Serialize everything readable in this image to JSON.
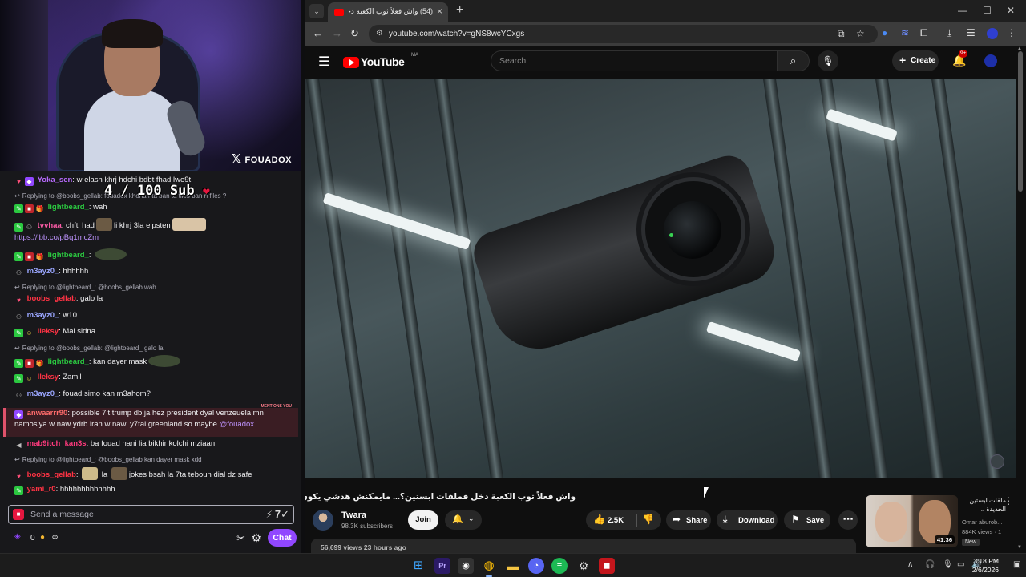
{
  "stream": {
    "overlay_tag": "FOUADOX",
    "goal_text": "4 / 100 Sub"
  },
  "chat": {
    "messages": [
      {
        "user": "Yoka_sen",
        "user_color": "#b96bff",
        "text": "w elash khrj hdchi bdbt fhad lwe9t"
      },
      {
        "reply": "Replying to @boobs_gellab: fouadox khona nta ban ta tiles ban ri files ?"
      },
      {
        "user": "lightbeard_",
        "user_color": "#2bc840",
        "text": "wah"
      },
      {
        "user": "tvvhaa",
        "user_color": "#ff5ca8",
        "text": "chfti had",
        "text2": "li khrj 3la eipsten",
        "link": "https://ibb.co/pBq1mcZm"
      },
      {
        "user": "lightbeard_",
        "user_color": "#2bc840",
        "text": ""
      },
      {
        "user": "m3ayz0_",
        "user_color": "#9aa6ff",
        "text": "hhhhhh"
      },
      {
        "reply": "Replying to @lightbeard_: @boobs_gellab wah"
      },
      {
        "user": "boobs_gellab",
        "user_color": "#ff3344",
        "text": "galo la"
      },
      {
        "user": "m3ayz0_",
        "user_color": "#9aa6ff",
        "text": "w10"
      },
      {
        "user": "lleksy",
        "user_color": "#ff3344",
        "text": "Mal sidna"
      },
      {
        "reply": "Replying to @boobs_gellab: @lightbeard_ galo la"
      },
      {
        "user": "lightbeard_",
        "user_color": "#2bc840",
        "text": "kan dayer mask"
      },
      {
        "user": "lleksy",
        "user_color": "#ff3344",
        "text": "Zamil"
      },
      {
        "user": "m3ayz0_",
        "user_color": "#9aa6ff",
        "text": "fouad simo kan m3ahom?"
      },
      {
        "user": "anwaarrr90",
        "user_color": "#ff6b6b",
        "text": "possible 7it trump db ja hez president dyal venzeuela mn",
        "text2": "namosiya w naw ydrb iran w nawi y7tal greenland so maybe",
        "mention": "@fouadox",
        "mention_label": "MENTIONS YOU"
      },
      {
        "user": "mab9itch_kan3s",
        "user_color": "#ff3a7d",
        "text": "ba fouad hani lia bikhir kolchi mziaan"
      },
      {
        "reply": "Replying to @lightbeard_: @boobs_gellab kan dayer mask xdd"
      },
      {
        "user": "boobs_gellab",
        "user_color": "#ff3344",
        "text": "la",
        "text2": "la",
        "text3": "jokes bsah la 7ta teboun dial dz safe"
      },
      {
        "user": "yami_r0",
        "user_color": "#2bc840",
        "text": "hhhhhhhhhhhhh"
      }
    ],
    "input_placeholder": "Send a message",
    "points": "0",
    "infinity": "∞",
    "chat_button": "Chat"
  },
  "browser": {
    "tab_title": "(54) واش فعلاً ثوب الكعبة دخل ف...",
    "url": "youtube.com/watch?v=gNS8wcYCxgs"
  },
  "youtube": {
    "logo_text": "YouTube",
    "country_code": "MA",
    "search_placeholder": "Search",
    "create_label": "Create",
    "notif_count": "9+",
    "video_title": "واش فعلاً ثوب الكعبة دخل فملفات ابستين؟... مايمكنش هدشي يكون حقيقي!",
    "channel_name": "Twara",
    "subscribers": "98.3K subscribers",
    "join_label": "Join",
    "likes": "2.5K",
    "share_label": "Share",
    "download_label": "Download",
    "save_label": "Save",
    "views_line": "56,699 views  23 hours ago",
    "suggestion": {
      "title": "ملفات ابستين الجديدة ...",
      "channel": "Omar aburob...",
      "views": "884K views · 1",
      "duration": "41:36",
      "badge": "New"
    }
  },
  "taskbar": {
    "time": "3:18 PM",
    "date": "2/6/2026"
  }
}
